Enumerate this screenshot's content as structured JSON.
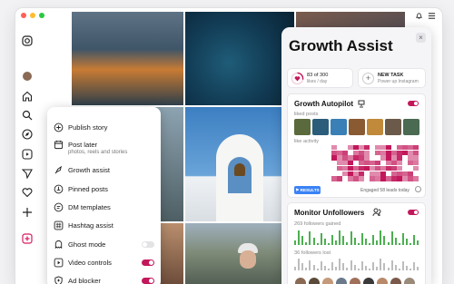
{
  "window": {
    "controls": [
      "close",
      "minimize",
      "maximize"
    ]
  },
  "sidebar": {
    "icons": [
      "instagram-icon",
      "avatar",
      "home-icon",
      "search-icon",
      "compass-icon",
      "reels-icon",
      "send-icon",
      "heart-icon",
      "add-icon",
      "plus-square-icon"
    ]
  },
  "menu": {
    "items": [
      {
        "label": "Publish story",
        "icon": "plus-circle-icon"
      },
      {
        "label": "Post later",
        "sub": "photos, reels and stories",
        "icon": "calendar-icon"
      },
      {
        "label": "Growth assist",
        "icon": "rocket-icon"
      },
      {
        "label": "Pinned posts",
        "icon": "pin-icon"
      },
      {
        "label": "DM templates",
        "icon": "chat-icon"
      },
      {
        "label": "Hashtag assist",
        "icon": "hashtag-icon"
      },
      {
        "label": "Ghost mode",
        "icon": "ghost-icon",
        "toggle": false
      },
      {
        "label": "Video controls",
        "icon": "play-icon",
        "toggle": true
      },
      {
        "label": "Ad blocker",
        "icon": "shield-icon",
        "toggle": true
      }
    ]
  },
  "panel": {
    "title": "Growth Assist",
    "likes": {
      "value": "83 of 300",
      "sub": "likes / day",
      "progress": 0.28
    },
    "new_task": {
      "label": "NEW TASK",
      "sub": "Power up Instagram"
    },
    "autopilot": {
      "title": "Growth Autopilot",
      "liked_posts": "liked posts",
      "like_activity": "like activity",
      "results": "RESULTS",
      "engaged": "Engaged 58 leads today"
    },
    "unfollowers": {
      "title": "Monitor Unfollowers",
      "gained": "269 followers gained",
      "lost": "36 followers lost"
    }
  },
  "colors": {
    "accent": "#c2185b",
    "blue": "#3b82f6"
  }
}
